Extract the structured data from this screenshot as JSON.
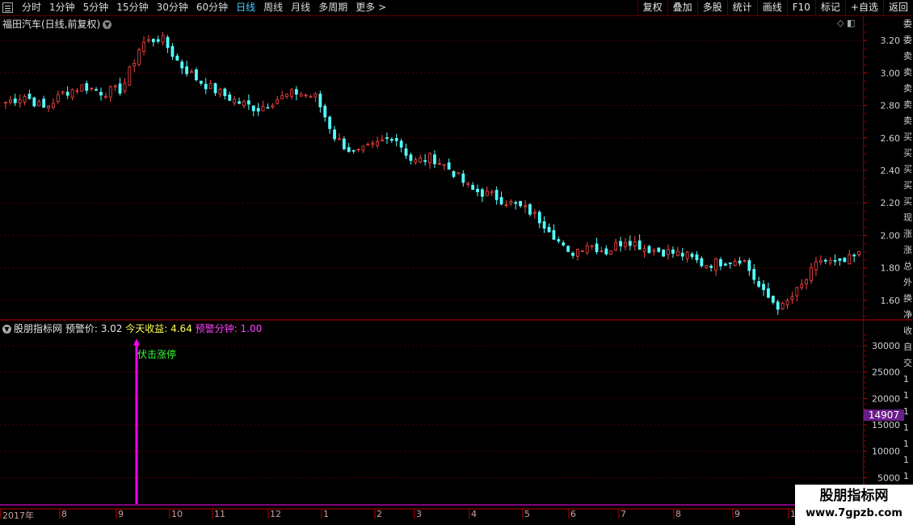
{
  "toolbar": {
    "periods": [
      "分时",
      "1分钟",
      "5分钟",
      "15分钟",
      "30分钟",
      "60分钟",
      "日线",
      "周线",
      "月线",
      "多周期",
      "更多 >"
    ],
    "active_period": "日线",
    "tools": [
      "复权",
      "叠加",
      "多股",
      "统计",
      "画线",
      "F10",
      "标记",
      "+自选",
      "返回"
    ]
  },
  "main_chart": {
    "title": "福田汽车(日线,前复权)",
    "y_ticks": [
      "3.20",
      "3.00",
      "2.80",
      "2.60",
      "2.40",
      "2.20",
      "2.00",
      "1.80",
      "1.60"
    ]
  },
  "indicator": {
    "name": "股朋指标网",
    "warn_price_label": "预警价: 3.02",
    "profit_label": "今天收益: 4.64",
    "warn_minute_label": "预警分钟: 1.00",
    "signal_label": "伏击涨停",
    "y_ticks": [
      "30000",
      "25000",
      "20000",
      "15000",
      "10000",
      "5000"
    ],
    "current_value": "14907"
  },
  "time_axis": {
    "labels": [
      "2017年",
      "8",
      "9",
      "10",
      "11",
      "12",
      "1",
      "2",
      "3",
      "4",
      "5",
      "6",
      "7",
      "8",
      "9",
      "10"
    ]
  },
  "right_panel": {
    "chars": [
      "委",
      "委",
      "卖",
      "卖",
      "卖",
      "卖",
      "卖",
      "买",
      "买",
      "买",
      "买",
      "买",
      "现",
      "涨",
      "涨",
      "总",
      "外",
      "换",
      "净",
      "收"
    ],
    "chars_lower": [
      "自",
      "交",
      "1",
      "1",
      "1",
      "1",
      "1",
      "1",
      "1",
      "1"
    ]
  },
  "watermark": {
    "line1": "股朋指标网",
    "line2": "www.7gpzb.com"
  },
  "colors": {
    "up": "#ff4545",
    "down": "#54ffff",
    "axis_red": "#c00000",
    "signal": "#ff00ff",
    "active": "#46d1ff"
  },
  "chart_data": {
    "type": "candlestick",
    "ylim": [
      1.5,
      3.3
    ],
    "seed_closes": [
      2.82,
      2.86,
      2.78,
      2.88,
      2.92,
      2.88,
      2.9,
      3.18,
      3.22,
      3.05,
      2.95,
      2.88,
      2.82,
      2.78,
      2.84,
      2.88,
      2.85,
      2.6,
      2.5,
      2.55,
      2.62,
      2.45,
      2.48,
      2.4,
      2.28,
      2.25,
      2.2,
      2.15,
      2.05,
      1.88,
      1.95,
      1.9,
      1.98,
      1.92,
      1.9,
      1.88,
      1.82,
      1.84,
      1.86,
      1.65,
      1.55,
      1.68,
      1.85,
      1.82,
      1.88
    ],
    "signal_value": 31000,
    "sub_ylim": [
      0,
      32000
    ]
  }
}
